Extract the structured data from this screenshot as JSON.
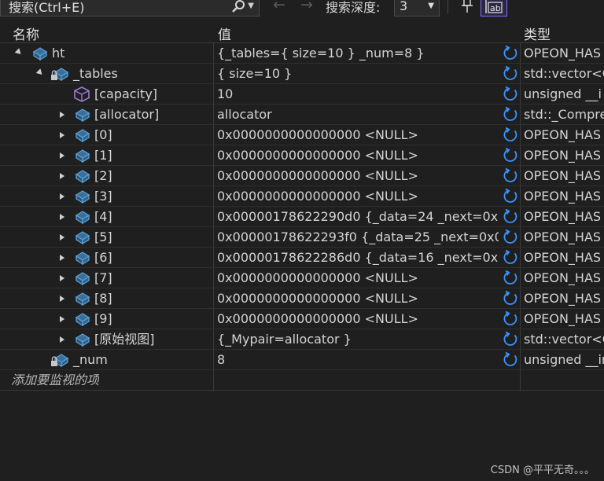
{
  "toolbar": {
    "search_placeholder": "搜索(Ctrl+E)",
    "depth_label": "搜索深度:",
    "depth_value": "3",
    "icons": [
      "search-icon",
      "back-arrow-icon",
      "forward-arrow-icon",
      "pin-icon",
      "ab-icon"
    ]
  },
  "columns": {
    "name": "名称",
    "value": "值",
    "type": "类型"
  },
  "rows": [
    {
      "name": "ht",
      "value": "{_tables={ size=10 } _num=8 }",
      "type": "OPEON_HAS",
      "icon": "object-icon"
    },
    {
      "name": "_tables",
      "value": "{ size=10 }",
      "type": "std::vector<C",
      "icon": "private-field-icon"
    },
    {
      "name": "[capacity]",
      "value": "10",
      "type": "unsigned __i",
      "icon": "capacity-icon"
    },
    {
      "name": "[allocator]",
      "value": "allocator",
      "type": "std::_Compre",
      "icon": "object-icon"
    },
    {
      "name": "[0]",
      "value": "0x0000000000000000 <NULL>",
      "type": "OPEON_HAS",
      "icon": "object-icon"
    },
    {
      "name": "[1]",
      "value": "0x0000000000000000 <NULL>",
      "type": "OPEON_HAS",
      "icon": "object-icon"
    },
    {
      "name": "[2]",
      "value": "0x0000000000000000 <NULL>",
      "type": "OPEON_HAS",
      "icon": "object-icon"
    },
    {
      "name": "[3]",
      "value": "0x0000000000000000 <NULL>",
      "type": "OPEON_HAS",
      "icon": "object-icon"
    },
    {
      "name": "[4]",
      "value": "0x00000178622290d0 {_data=24 _next=0x0...",
      "type": "OPEON_HAS",
      "icon": "object-icon"
    },
    {
      "name": "[5]",
      "value": "0x00000178622293f0 {_data=25 _next=0x0...",
      "type": "OPEON_HAS",
      "icon": "object-icon"
    },
    {
      "name": "[6]",
      "value": "0x00000178622286d0 {_data=16 _next=0x0...",
      "type": "OPEON_HAS",
      "icon": "object-icon"
    },
    {
      "name": "[7]",
      "value": "0x0000000000000000 <NULL>",
      "type": "OPEON_HAS",
      "icon": "object-icon"
    },
    {
      "name": "[8]",
      "value": "0x0000000000000000 <NULL>",
      "type": "OPEON_HAS",
      "icon": "object-icon"
    },
    {
      "name": "[9]",
      "value": "0x0000000000000000 <NULL>",
      "type": "OPEON_HAS",
      "icon": "object-icon"
    },
    {
      "name": "[原始视图]",
      "value": "{_Mypair=allocator }",
      "type": "std::vector<C",
      "icon": "object-icon"
    },
    {
      "name": "_num",
      "value": "8",
      "type": "unsigned __ir",
      "icon": "private-field-icon"
    }
  ],
  "add_watch_placeholder": "添加要监视的项",
  "watermark": "CSDN @平平无奇。。。",
  "colors": {
    "background": "#1f1f1f",
    "accent": "#8c6cff",
    "refresh": "#3794ff",
    "object_icon": "#5aa0d6"
  }
}
